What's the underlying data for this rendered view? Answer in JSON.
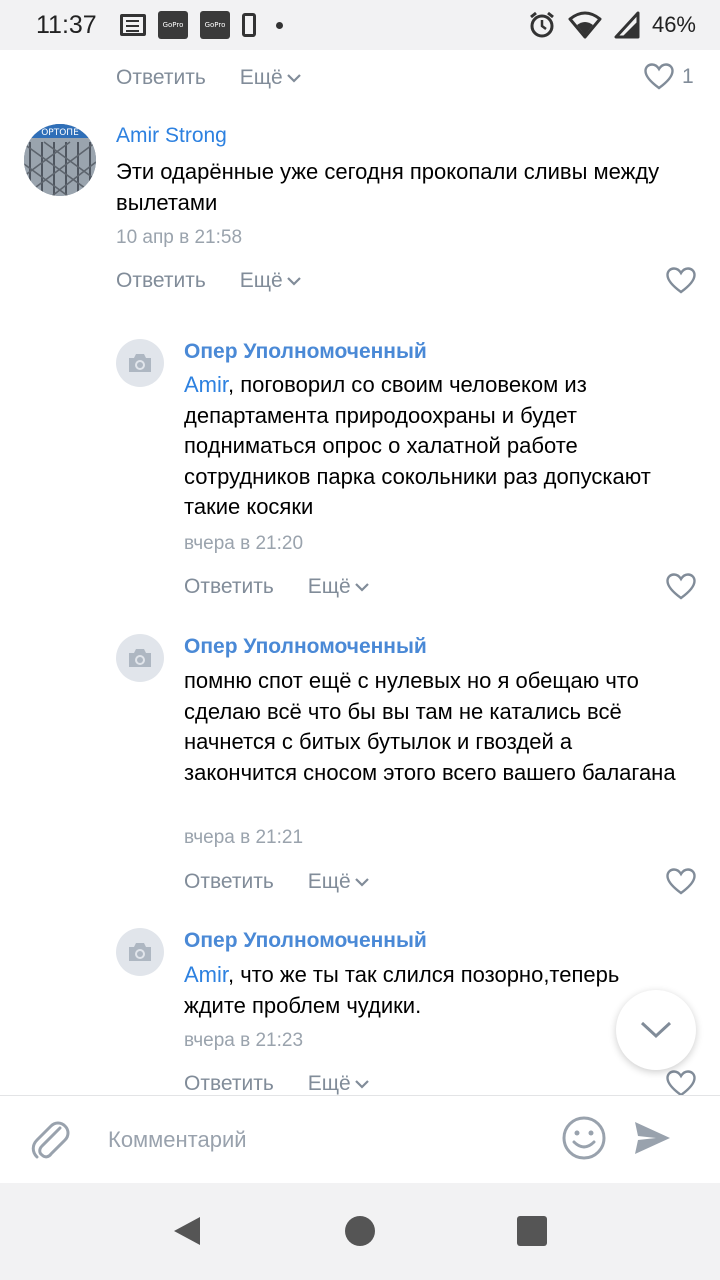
{
  "status_bar": {
    "time": "11:37",
    "gopro1": "GoPro",
    "gopro2": "GoPro",
    "battery": "46%"
  },
  "top_actions": {
    "reply": "Ответить",
    "more": "Ещё",
    "likes": "1"
  },
  "comments": [
    {
      "author": "Amir Strong",
      "text": "Эти одарённые уже сегодня прокопали сливы между вылетами",
      "time": "10 апр в 21:58",
      "reply": "Ответить",
      "more": "Ещё"
    },
    {
      "author": "Опер Уполномоченный",
      "mention": "Amir",
      "text": ", поговорил со своим человеком из департамента природоохраны и будет подниматься опрос о халатной работе сотрудников парка сокольники раз допускают такие косяки",
      "time": "вчера в 21:20",
      "reply": "Ответить",
      "more": "Ещё"
    },
    {
      "author": "Опер Уполномоченный",
      "text": "помню спот ещё с нулевых но я обещаю что сделаю всё что бы вы там не катались всё начнется с битых бутылок и гвоздей а закончится сносом этого всего вашего балагана",
      "time": "вчера в 21:21",
      "reply": "Ответить",
      "more": "Ещё"
    },
    {
      "author": "Опер Уполномоченный",
      "mention": "Amir",
      "text": ", что же ты так слился позорно,теперь ждите проблем чудики.",
      "time": "вчера в 21:23",
      "reply": "Ответить",
      "more": "Ещё"
    }
  ],
  "composer": {
    "placeholder": "Комментарий"
  },
  "icons": {
    "like": "heart-icon",
    "more": "chevron-down-icon",
    "attach": "paperclip-icon",
    "emoji": "smiley-icon",
    "send": "send-arrow-icon",
    "avatar_placeholder": "camera-icon"
  },
  "colors": {
    "link": "#2d81e0",
    "muted": "#818c99"
  }
}
